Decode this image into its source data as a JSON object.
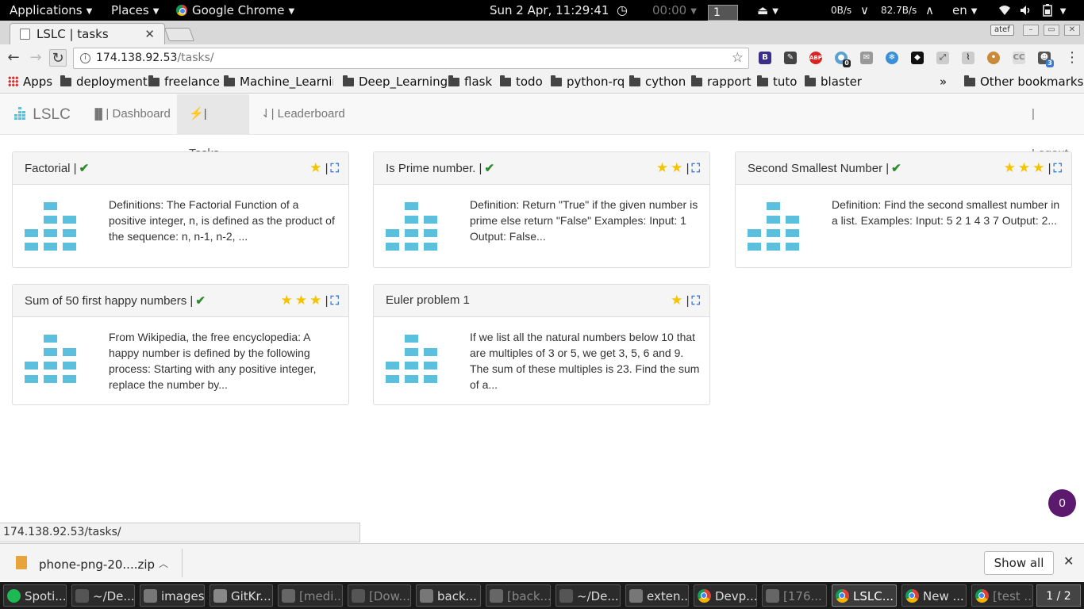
{
  "panel": {
    "applications": "Applications",
    "places": "Places",
    "active_app": "Google Chrome",
    "datetime": "Sun  2 Apr, 11:29:41",
    "timer": "00:00",
    "workspace": "1",
    "net_down": "0B/s",
    "net_up": "82.7B/s",
    "lang": "en"
  },
  "browser": {
    "tab_title": "LSLC | tasks",
    "url_host": "174.138.92.53",
    "url_path": "/tasks/",
    "profile": "atef",
    "ext_badge_dark": "0",
    "ext_badge_blue": "3",
    "bookmarks": [
      "Apps",
      "deployment",
      "freelance",
      "Machine_Learning",
      "Deep_Learning",
      "flask",
      "todo",
      "python-rq",
      "cython",
      "rapport",
      "tuto",
      "blaster"
    ],
    "bookmarks_overflow": "»",
    "other_bookmarks": "Other bookmarks",
    "status_url": "174.138.92.53/tasks/"
  },
  "navbar": {
    "brand": "LSLC",
    "dashboard": "| Dashboard",
    "tasks": "| Tasks",
    "leaderboard": "| Leaderboard",
    "logout": "| Logout"
  },
  "tasks": [
    {
      "title": "Factorial |",
      "solved": true,
      "stars": 1,
      "sep": "|",
      "text": "Definitions: The Factorial Function of a positive integer, n, is defined as the product of the sequence: n, n-1, n-2, ..."
    },
    {
      "title": "Is Prime number. |",
      "solved": true,
      "stars": 2,
      "sep": "|",
      "text": "Definition: Return \"True\" if the given number is prime else return \"False\" Examples: Input: 1 Output: False..."
    },
    {
      "title": "Second Smallest Number |",
      "solved": true,
      "stars": 3,
      "sep": "|",
      "text": "Definition: Find the second smallest number in a list. Examples: Input: 5 2 1 4 3 7 Output: 2..."
    },
    {
      "title": "Sum of 50 first happy numbers |",
      "solved": true,
      "stars": 3,
      "sep": "|",
      "text": "From Wikipedia, the free encyclopedia: A happy number is defined by the following process: Starting with any positive integer, replace the number by..."
    },
    {
      "title": "Euler problem 1",
      "solved": false,
      "stars": 1,
      "sep": "|",
      "text": "If we list all the natural numbers below 10 that are multiples of 3 or 5, we get 3, 5, 6 and 9. The sum of these multiples is 23. Find the sum of a..."
    }
  ],
  "fab_count": "0",
  "downloads": {
    "file": "phone-png-20....zip",
    "show_all": "Show all"
  },
  "taskbar": {
    "items": [
      "Spoti...",
      "~/De...",
      "images",
      "GitKr...",
      "[medi...",
      "[Dow...",
      "back...",
      "[back...",
      "~/De...",
      "exten...",
      "Devp...",
      "[176...",
      "LSLC...",
      "New ...",
      "[test ..."
    ],
    "pager": "1 / 2"
  },
  "colors": {
    "accent_tile": "#5bc0de",
    "star": "#f5c400",
    "check": "#2e8b2e",
    "fab": "#5c1a6e"
  }
}
